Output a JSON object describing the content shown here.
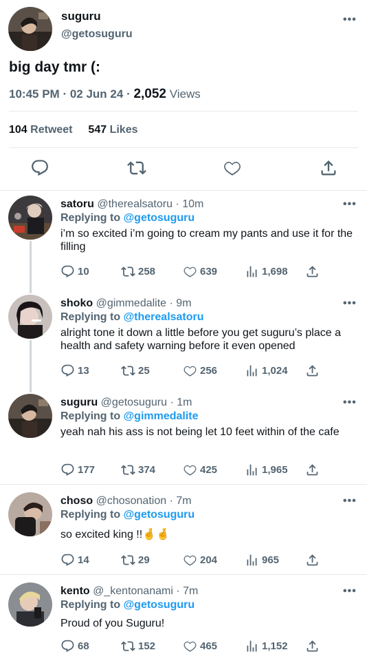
{
  "tweet": {
    "name": "suguru",
    "handle": "@getosuguru",
    "text": "big day tmr (:",
    "time": "10:45 PM",
    "date": "02 Jun 24",
    "views_count": "2,052",
    "views_label": "Views",
    "retweets_count": "104",
    "retweets_label": "Retweet",
    "likes_count": "547",
    "likes_label": "Likes",
    "more_icon": "more-icon",
    "actions": [
      "reply-icon",
      "retweet-icon",
      "like-icon",
      "share-icon"
    ]
  },
  "replying_label": "Replying to",
  "replies": [
    {
      "name": "satoru",
      "handle": "@therealsatoru",
      "time": "· 10m",
      "replying_to": "@getosuguru",
      "text": "i’m so excited i’m going to cream my pants and use it for the filling",
      "replies": "10",
      "retweets": "258",
      "likes": "639",
      "views": "1,698"
    },
    {
      "name": "shoko",
      "handle": "@gimmedalite",
      "time": "· 9m",
      "replying_to": "@therealsatoru",
      "text": "alright tone it down a little before you get suguru’s place a health and safety warning before it even opened",
      "replies": "13",
      "retweets": "25",
      "likes": "256",
      "views": "1,024"
    },
    {
      "name": "suguru",
      "handle": "@getosuguru",
      "time": "· 1m",
      "replying_to": "@gimmedalite",
      "text": "yeah nah his ass is not being let 10 feet within of the cafe",
      "replies": "177",
      "retweets": "374",
      "likes": "425",
      "views": "1,965"
    },
    {
      "name": "choso",
      "handle": "@chosonation",
      "time": "· 7m",
      "replying_to": "@getosuguru",
      "text": "so excited king !!🤞🤞",
      "replies": "14",
      "retweets": "29",
      "likes": "204",
      "views": "965"
    },
    {
      "name": "kento",
      "handle": "@_kentonanami",
      "time": "· 7m",
      "replying_to": "@getosuguru",
      "text": "Proud of you Suguru!",
      "replies": "68",
      "retweets": "152",
      "likes": "465",
      "views": "1,152"
    }
  ],
  "colors": {
    "text": "#0f1419",
    "muted": "#536471",
    "link": "#1d9bf0",
    "divider": "#e6e9ec",
    "thread_line": "#d2d7db"
  }
}
